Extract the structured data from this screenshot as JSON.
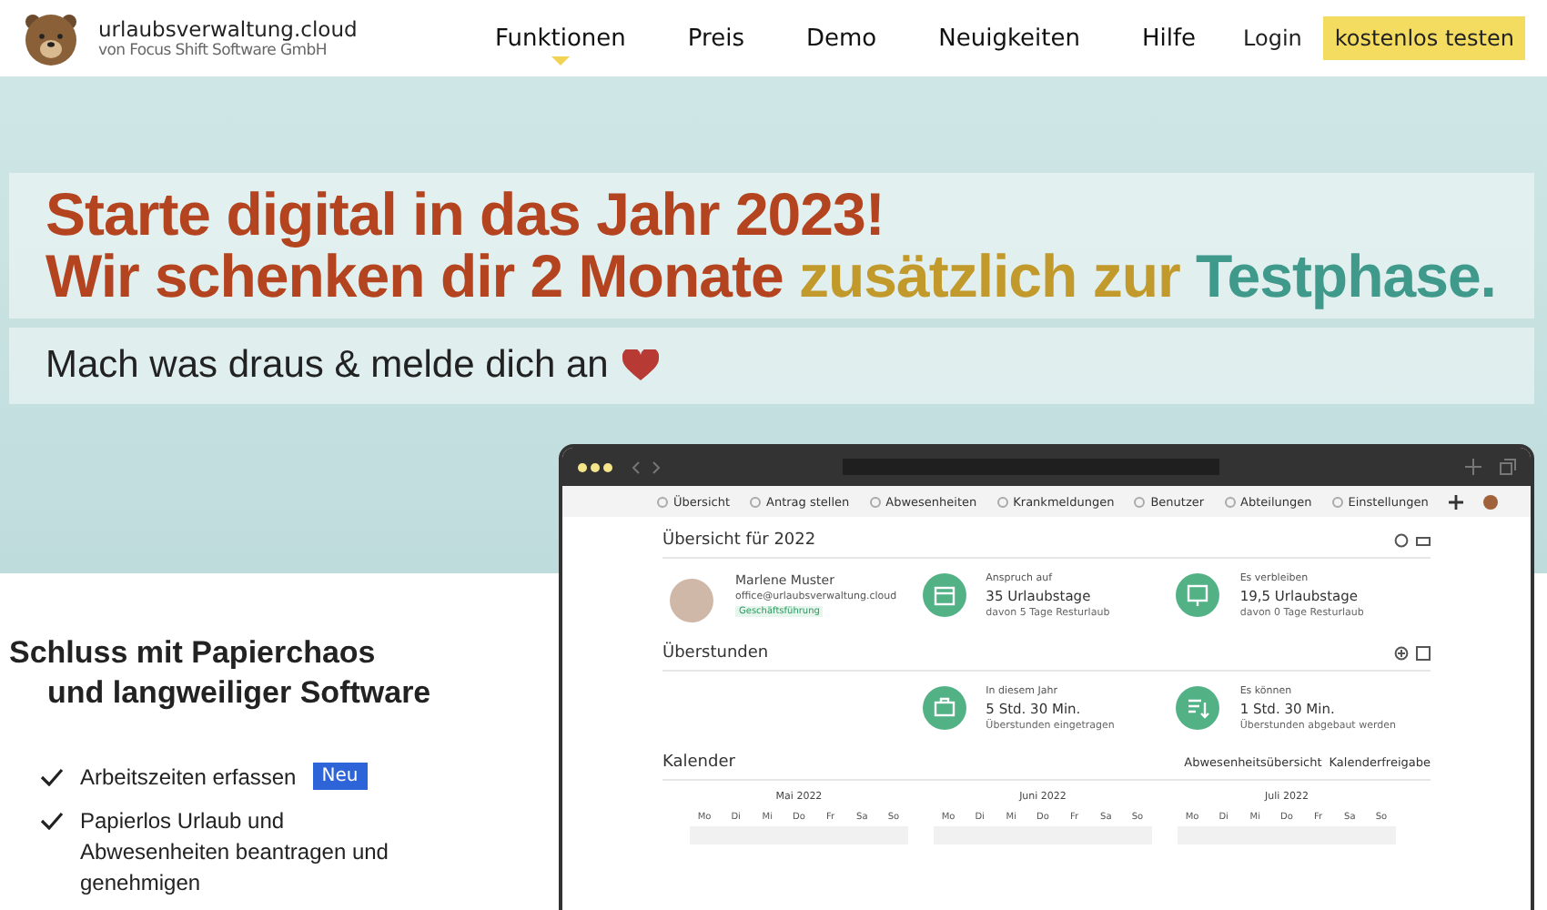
{
  "header": {
    "brand": "urlaubsverwaltung.cloud",
    "brand_sub": "von Focus Shift Software GmbH",
    "nav": [
      {
        "label": "Funktionen",
        "selected": true
      },
      {
        "label": "Preis",
        "selected": false
      },
      {
        "label": "Demo",
        "selected": false
      },
      {
        "label": "Neuigkeiten",
        "selected": false
      },
      {
        "label": "Hilfe",
        "selected": false
      }
    ],
    "login": "Login",
    "cta": "kostenlos testen"
  },
  "banner": {
    "lines": [
      [
        {
          "text": "Starte digital in das Jahr 2023!",
          "color": "#b4441f"
        }
      ],
      [
        {
          "text": "Wir schenken dir 2 Monate",
          "color": "#b4441f"
        },
        {
          "text": "zusätzlich zur",
          "color": "#c29a2c"
        },
        {
          "text": "Testphase.",
          "color": "#3f9a8c"
        }
      ]
    ],
    "sub": "Mach was draus & melde dich an"
  },
  "intro": {
    "heading_1": "Schluss mit Papierchaos",
    "heading_2": "und langweiliger Software",
    "features": [
      {
        "text": "Arbeitszeiten erfassen",
        "badge": "Neu"
      },
      {
        "text": "Papierlos Urlaub und Abwesenheiten beantragen und genehmigen"
      }
    ]
  },
  "app": {
    "nav": [
      "Übersicht",
      "Antrag stellen",
      "Abwesenheiten",
      "Krankmeldungen",
      "Benutzer",
      "Abteilungen",
      "Einstellungen"
    ],
    "overview_title": "Übersicht für 2022",
    "user": {
      "name": "Marlene Muster",
      "email": "office@urlaubsverwaltung.cloud",
      "role": "Geschäftsführung"
    },
    "stats": [
      {
        "kind": "calendar",
        "label": "Anspruch auf",
        "value": "35 Urlaubstage",
        "note": "davon 5 Tage Resturlaub"
      },
      {
        "kind": "board",
        "label": "Es verbleiben",
        "value": "19,5 Urlaubstage",
        "note": "davon 0 Tage Resturlaub"
      }
    ],
    "overtime_title": "Überstunden",
    "overtime": [
      {
        "kind": "briefcase",
        "label": "In diesem Jahr",
        "value": "5 Std. 30 Min.",
        "note": "Überstunden eingetragen"
      },
      {
        "kind": "list",
        "label": "Es können",
        "value": "1 Std. 30 Min.",
        "note": "Überstunden abgebaut werden"
      }
    ],
    "calendar_title": "Kalender",
    "calendar_links": [
      "Abwesenheitsübersicht",
      "Kalenderfreigabe"
    ],
    "months": [
      {
        "name": "Mai 2022",
        "days": [
          "Mo",
          "Di",
          "Mi",
          "Do",
          "Fr",
          "Sa",
          "So"
        ]
      },
      {
        "name": "Juni 2022",
        "days": [
          "Mo",
          "Di",
          "Mi",
          "Do",
          "Fr",
          "Sa",
          "So"
        ]
      },
      {
        "name": "Juli 2022",
        "days": [
          "Mo",
          "Di",
          "Mi",
          "Do",
          "Fr",
          "Sa",
          "So"
        ]
      }
    ]
  }
}
